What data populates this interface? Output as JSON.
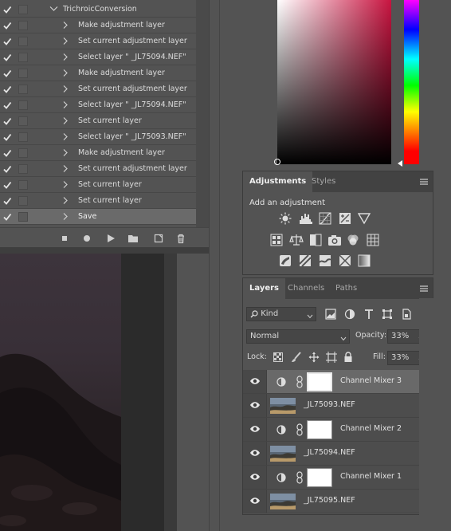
{
  "actions": {
    "set_name": "TrichroicConversion",
    "items": [
      {
        "label": "Make adjustment layer"
      },
      {
        "label": "Set current adjustment layer"
      },
      {
        "label": "Select layer \" _JL75094.NEF\""
      },
      {
        "label": "Make adjustment layer"
      },
      {
        "label": "Set current adjustment layer"
      },
      {
        "label": "Select layer \" _JL75094.NEF\""
      },
      {
        "label": "Set current layer"
      },
      {
        "label": "Select layer \" _JL75093.NEF\""
      },
      {
        "label": "Make adjustment layer"
      },
      {
        "label": "Set current adjustment layer"
      },
      {
        "label": "Set current layer"
      },
      {
        "label": "Set current layer"
      },
      {
        "label": "Save"
      }
    ],
    "toolbar_icons": [
      "stop-icon",
      "record-icon",
      "play-icon",
      "folder-icon",
      "new-action-icon",
      "trash-icon"
    ]
  },
  "color": {
    "field_hue": "#c81440"
  },
  "adjustments": {
    "tabs": [
      {
        "label": "Adjustments",
        "active": true
      },
      {
        "label": "Styles",
        "active": false
      }
    ],
    "heading": "Add an adjustment",
    "icon_rows": [
      [
        "brightness-contrast-icon",
        "levels-icon",
        "curves-icon",
        "exposure-icon",
        "vibrance-triangle-icon"
      ],
      [
        "hue-saturation-icon",
        "color-balance-icon",
        "black-white-icon",
        "photo-filter-icon",
        "channel-mixer-icon",
        "color-lookup-icon"
      ],
      [
        "invert-icon",
        "posterize-icon",
        "threshold-icon",
        "selective-color-icon",
        "gradient-map-icon"
      ]
    ]
  },
  "layers": {
    "tabs": [
      {
        "label": "Layers",
        "active": true
      },
      {
        "label": "Channels",
        "active": false
      },
      {
        "label": "Paths",
        "active": false
      }
    ],
    "filter_kind": "Kind",
    "blend_mode": "Normal",
    "opacity_label": "Opacity:",
    "opacity": "33%",
    "lock_label": "Lock:",
    "fill_label": "Fill:",
    "fill": "33%",
    "rows": [
      {
        "name": "Channel Mixer 3",
        "type": "adjustment",
        "selected": true
      },
      {
        "name": "_JL75093.NEF",
        "type": "image",
        "selected": false
      },
      {
        "name": "Channel Mixer 2",
        "type": "adjustment",
        "selected": false
      },
      {
        "name": "_JL75094.NEF",
        "type": "image",
        "selected": false
      },
      {
        "name": "Channel Mixer 1",
        "type": "adjustment",
        "selected": false
      },
      {
        "name": "_JL75095.NEF",
        "type": "image",
        "selected": false
      }
    ]
  }
}
